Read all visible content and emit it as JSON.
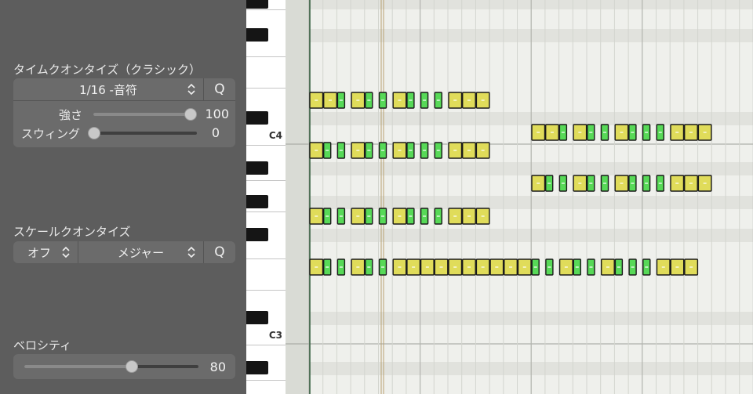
{
  "time_quantize": {
    "title": "タイムクオンタイズ（クラシック）",
    "value": "1/16 -音符",
    "q_label": "Q",
    "strength": {
      "label": "強さ",
      "value": "100",
      "fraction": 1.0
    },
    "swing": {
      "label": "スウィング",
      "value": "0",
      "fraction": 0.0
    }
  },
  "scale_quantize": {
    "title": "スケールクオンタイズ",
    "root": "オフ",
    "scale": "メジャー",
    "q_label": "Q"
  },
  "velocity": {
    "title": "ベロシティ",
    "value": "80",
    "fraction": 0.63
  },
  "keyboard": {
    "labels": [
      "C4",
      "C3"
    ]
  },
  "piano_roll": {
    "note_colors": {
      "yellow": "#e0dc5a",
      "green": "#57d957"
    },
    "note_groups": [
      {
        "row": "upper",
        "pattern": [
          "Y",
          "Y",
          "G",
          "Y",
          "G",
          "G",
          "Y",
          "G",
          "G",
          "G",
          "Y",
          "Y",
          "Y"
        ]
      },
      {
        "row": "upper2",
        "pattern": [
          "Y",
          "G",
          "G",
          "Y",
          "G",
          "G",
          "Y",
          "G",
          "G",
          "G",
          "Y",
          "Y",
          "Y"
        ]
      },
      {
        "row": "upper3",
        "pattern": [
          "Y",
          "G",
          "G",
          "Y",
          "G",
          "G",
          "Y",
          "G",
          "G",
          "G",
          "Y",
          "Y",
          "Y"
        ]
      },
      {
        "row": "bottom",
        "pattern": [
          "Y",
          "G",
          "G",
          "Y",
          "G",
          "G",
          "Y",
          "Y",
          "Y",
          "Y",
          "Y",
          "Y",
          "Y",
          "Y",
          "Y",
          "Y",
          "G",
          "G",
          "Y",
          "G",
          "G",
          "Y",
          "G",
          "G",
          "G",
          "Y",
          "Y",
          "Y"
        ]
      },
      {
        "row": "right1",
        "pattern": [
          "Y",
          "Y",
          "G",
          "Y",
          "G",
          "G",
          "Y",
          "G",
          "G",
          "G",
          "Y",
          "Y",
          "Y"
        ]
      },
      {
        "row": "right2",
        "pattern": [
          "Y",
          "G",
          "G",
          "Y",
          "G",
          "G",
          "Y",
          "G",
          "G",
          "G",
          "Y",
          "Y",
          "Y"
        ]
      }
    ]
  }
}
